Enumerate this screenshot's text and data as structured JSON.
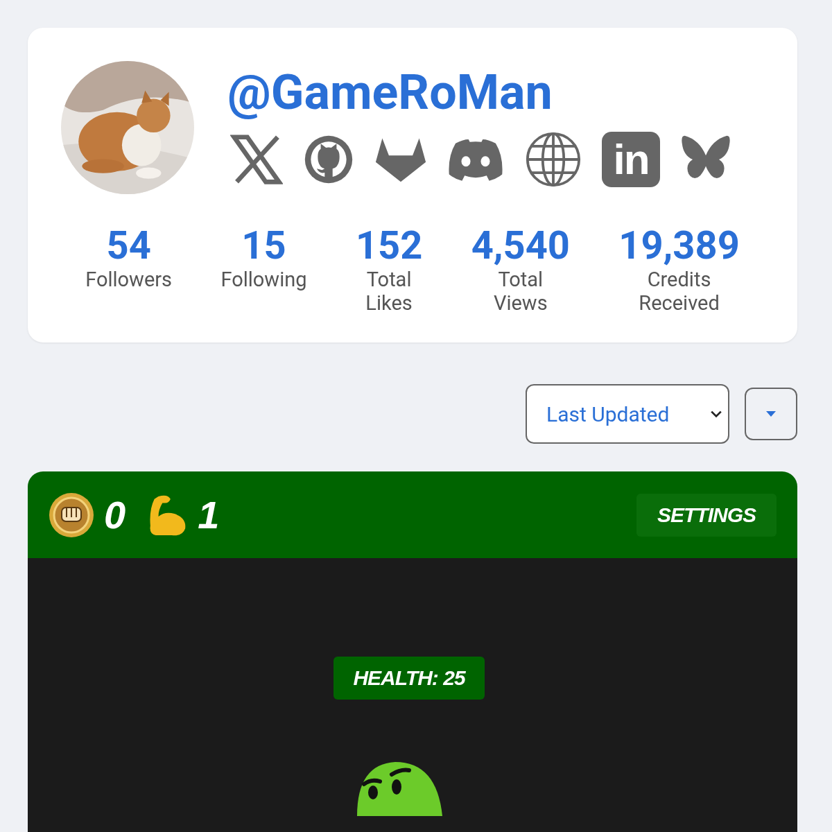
{
  "profile": {
    "username": "@GameRoMan",
    "socials": [
      {
        "kind": "x"
      },
      {
        "kind": "github"
      },
      {
        "kind": "gitlab"
      },
      {
        "kind": "discord"
      },
      {
        "kind": "globe"
      },
      {
        "kind": "linkedin",
        "label": "in"
      },
      {
        "kind": "bluesky"
      }
    ],
    "stats": [
      {
        "value": "54",
        "label": "Followers"
      },
      {
        "value": "15",
        "label": "Following"
      },
      {
        "value": "152",
        "label": "Total\nLikes"
      },
      {
        "value": "4,540",
        "label": "Total\nViews"
      },
      {
        "value": "19,389",
        "label": "Credits\nReceived"
      }
    ]
  },
  "sort": {
    "value": "Last Updated"
  },
  "game": {
    "coins": "0",
    "strength": "1",
    "settings": "SETTINGS",
    "health": "HEALTH: 25"
  }
}
